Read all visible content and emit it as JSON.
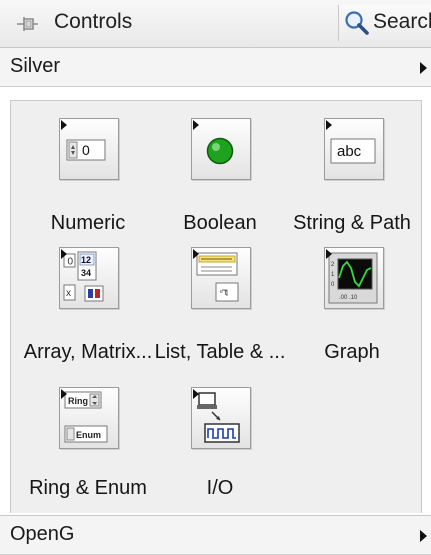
{
  "palette": {
    "title": "Controls",
    "search_label": "Search"
  },
  "categories": {
    "silver": "Silver",
    "openg": "OpenG"
  },
  "items": [
    {
      "label": "Numeric",
      "icon": "numeric-control-icon"
    },
    {
      "label": "Boolean",
      "icon": "boolean-led-icon"
    },
    {
      "label": "String & Path",
      "icon": "string-control-icon"
    },
    {
      "label": "Array, Matrix...",
      "icon": "array-matrix-icon"
    },
    {
      "label": "List, Table & ...",
      "icon": "list-table-icon"
    },
    {
      "label": "Graph",
      "icon": "waveform-graph-icon"
    },
    {
      "label": "Ring & Enum",
      "icon": "ring-enum-icon"
    },
    {
      "label": "I/O",
      "icon": "io-icon"
    }
  ],
  "icon_text": {
    "numeric_value": "0",
    "string_value": "abc",
    "array_value_top": "12",
    "array_value_bottom": "34",
    "ring_text": "Ring",
    "enum_text": "Enum"
  },
  "colors": {
    "led_green": "#1fa31f",
    "graph_background": "#0b0b0b",
    "graph_trace": "#2fe03a",
    "title_bar": "#eeeeee",
    "category_bar": "#f4f4f4"
  }
}
